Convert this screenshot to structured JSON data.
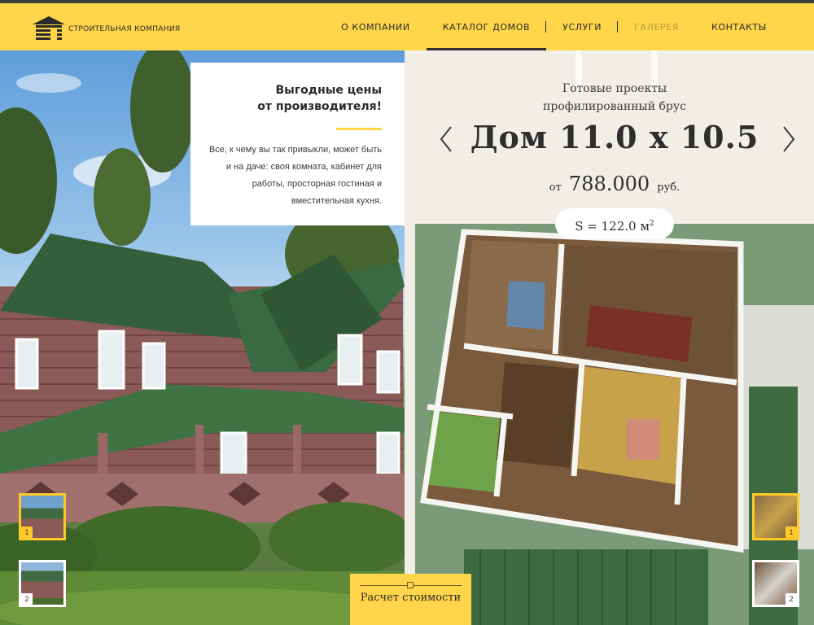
{
  "header": {
    "logo_text": "СТРОИТЕЛЬНАЯ КОМПАНИЯ",
    "nav": [
      {
        "label": "О КОМПАНИИ"
      },
      {
        "label": "КАТАЛОГ ДОМОВ"
      },
      {
        "label": "УСЛУГИ"
      },
      {
        "label": "ГАЛЕРЕЯ"
      },
      {
        "label": "КОНТАКТЫ"
      }
    ],
    "active_nav": "КАТАЛОГ ДОМОВ",
    "dim_nav": "ГАЛЕРЕЯ"
  },
  "promo": {
    "title_line1": "Выгодные цены",
    "title_line2": "от производителя!",
    "text": "Все, к чему вы так привыкли, может быть и на даче: своя комната, кабинет для работы, просторная гостиная и вместительная кухня."
  },
  "left_thumbs": [
    {
      "num": "1",
      "active": true
    },
    {
      "num": "2",
      "active": false
    }
  ],
  "calc_button": {
    "label": "Расчет стоимости"
  },
  "project": {
    "subtitle_line1": "Готовые проекты",
    "subtitle_line2": "профилированный брус",
    "title": "Дом 11.0 х 10.5",
    "price_prefix": "от",
    "price_value": "788.000",
    "price_currency": "руб.",
    "area_label": "S = 122.0 м",
    "area_sup": "2"
  },
  "right_thumbs": [
    {
      "num": "1",
      "active": true
    },
    {
      "num": "2",
      "active": false
    }
  ],
  "colors": {
    "accent": "#ffd54a",
    "header_line": "#3b3b3b",
    "text_dark": "#2e2e2e"
  },
  "icons": {
    "logo": "log-house-icon",
    "prev": "chevron-left-icon",
    "next": "chevron-right-icon"
  }
}
